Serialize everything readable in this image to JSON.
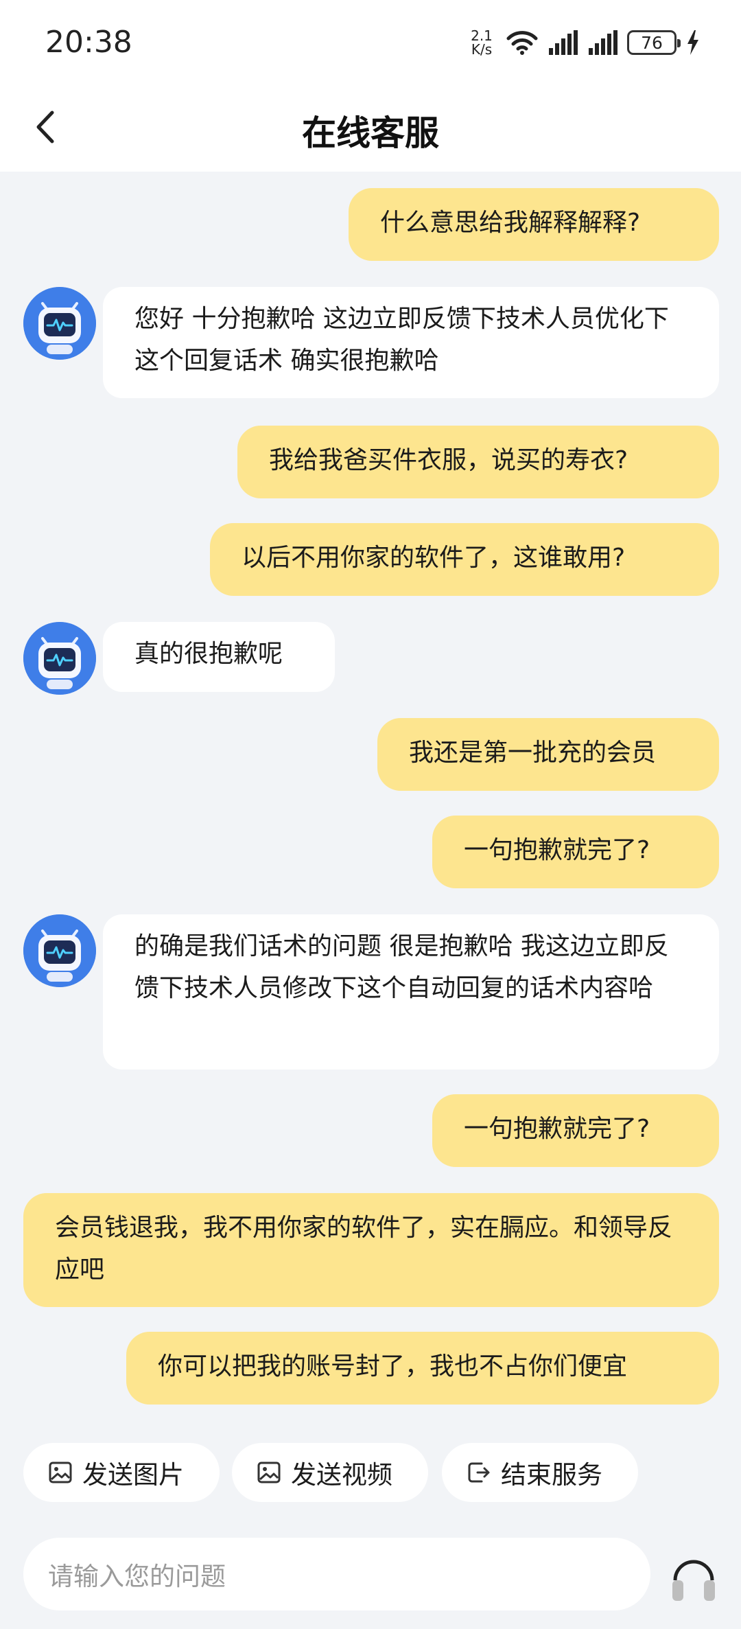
{
  "status": {
    "time": "20:38",
    "net_speed_value": "2.1",
    "net_speed_unit": "K/s",
    "battery": "76"
  },
  "header": {
    "title": "在线客服"
  },
  "messages": [
    {
      "from": "user",
      "text": "什么意思给我解释解释?"
    },
    {
      "from": "bot",
      "text": "您好 十分抱歉哈 这边立即反馈下技术人员优化下这个回复话术 确实很抱歉哈"
    },
    {
      "from": "user",
      "text": "我给我爸买件衣服，说买的寿衣?"
    },
    {
      "from": "user",
      "text": "以后不用你家的软件了，这谁敢用?"
    },
    {
      "from": "bot",
      "text": "真的很抱歉呢"
    },
    {
      "from": "user",
      "text": "我还是第一批充的会员"
    },
    {
      "from": "user",
      "text": "一句抱歉就完了?"
    },
    {
      "from": "bot",
      "text": "的确是我们话术的问题 很是抱歉哈 我这边立即反馈下技术人员修改下这个自动回复的话术内容哈"
    },
    {
      "from": "user",
      "text": "一句抱歉就完了?"
    },
    {
      "from": "user",
      "text": "会员钱退我，我不用你家的软件了，实在膈应。和领导反应吧"
    },
    {
      "from": "user",
      "text": "你可以把我的账号封了，我也不占你们便宜"
    }
  ],
  "quick_actions": [
    {
      "label": "发送图片",
      "icon": "image-icon"
    },
    {
      "label": "发送视频",
      "icon": "image-icon"
    },
    {
      "label": "结束服务",
      "icon": "exit-icon"
    }
  ],
  "input": {
    "placeholder": "请输入您的问题"
  },
  "colors": {
    "user_bubble": "#fde58f",
    "bot_bubble": "#ffffff",
    "background": "#f2f4f7",
    "avatar_bg": "#3f7ee8"
  }
}
